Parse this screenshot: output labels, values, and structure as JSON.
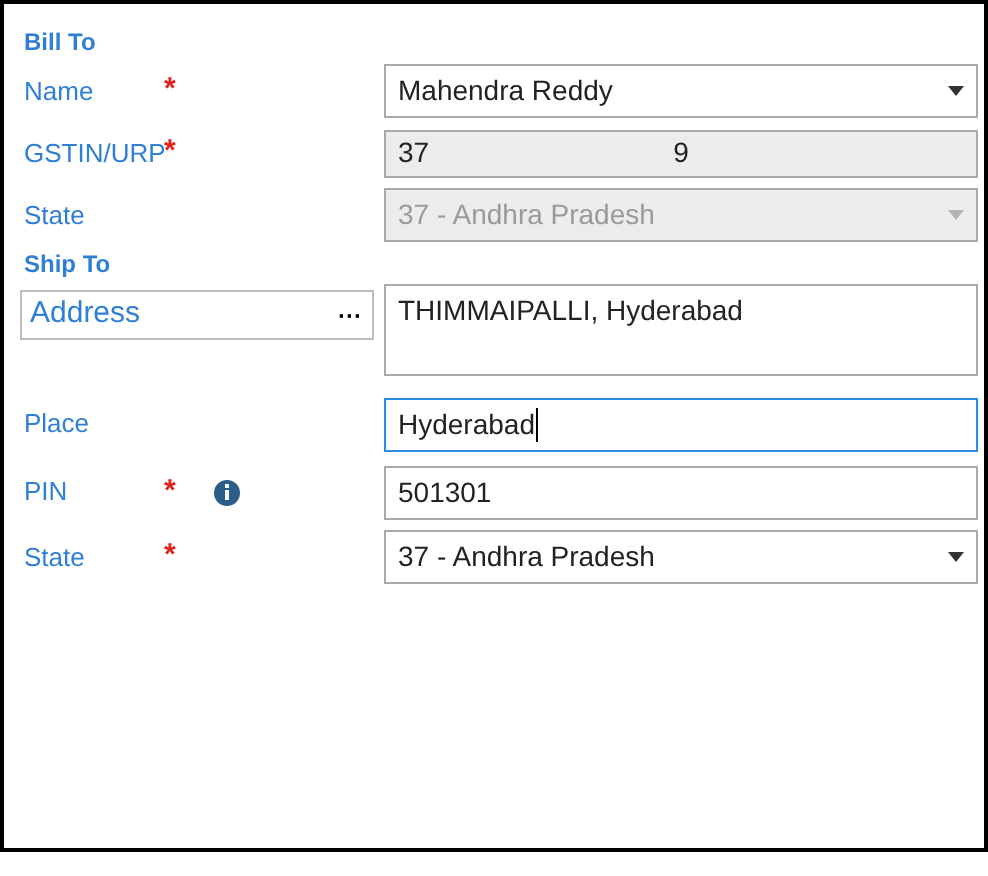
{
  "sections": [
    {
      "title": "Bill To",
      "fields": [
        {
          "kind": "dropdown",
          "label": "Name",
          "required_mark": "*",
          "value": "Mahendra Reddy",
          "disabled": false,
          "focused": false
        },
        {
          "kind": "masked",
          "label": "GSTIN/URP",
          "required_mark": "*",
          "value_start": "37",
          "value_end": "9",
          "disabled": true,
          "focused": false
        },
        {
          "kind": "dropdown",
          "label": "State",
          "value": "37 - Andhra Pradesh",
          "disabled": true,
          "focused": false
        }
      ]
    },
    {
      "title": "Ship To",
      "fields": [
        {
          "kind": "textarea",
          "label": "Address",
          "label_button": "···",
          "value": "THIMMAIPALLI, Hyderabad",
          "disabled": false,
          "focused": false
        },
        {
          "kind": "text",
          "label": "Place",
          "value": "Hyderabad",
          "disabled": false,
          "focused": true
        },
        {
          "kind": "text",
          "label": "PIN",
          "required_mark": "*",
          "info": true,
          "value": "501301",
          "disabled": false,
          "focused": false
        },
        {
          "kind": "dropdown",
          "label": "State",
          "required_mark": "*",
          "value": "37 - Andhra Pradesh",
          "disabled": false,
          "focused": false
        }
      ]
    }
  ]
}
